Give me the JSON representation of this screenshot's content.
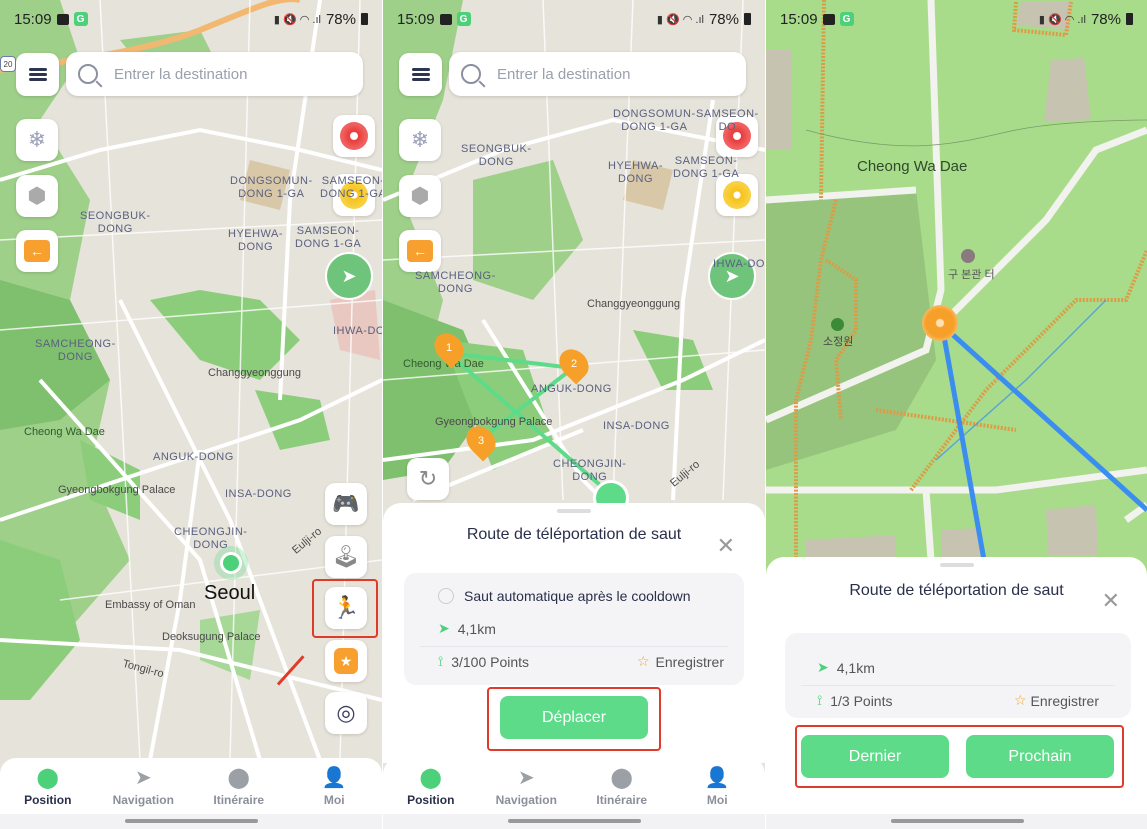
{
  "status_bar": {
    "time": "15:09",
    "battery": "78%"
  },
  "search": {
    "placeholder": "Entrer la destination"
  },
  "tabs": [
    {
      "label": "Position",
      "icon": "location-pin-icon",
      "active": true
    },
    {
      "label": "Navigation",
      "icon": "paper-plane-icon",
      "active": false
    },
    {
      "label": "Itinéraire",
      "icon": "route-icon",
      "active": false
    },
    {
      "label": "Moi",
      "icon": "user-icon",
      "active": false
    }
  ],
  "panel1": {
    "map_labels": {
      "dongsomun": "DONGSOMUN-\nDONG 1-GA",
      "samseon": "SAMSEON-\nDONG 1-GA",
      "seongbuk": "SEONGBUK-\nDONG",
      "hyehwa": "HYEHWA-\nDONG",
      "samcheong": "SAMCHEONG-\nDONG",
      "ihwa": "IHWA-DO",
      "changgyeonggung": "Changgyeonggung",
      "cheong_wa_dae": "Cheong Wa Dae",
      "anguk": "ANGUK-DONG",
      "gyeongbokgung": "Gyeongbokgung Palace",
      "insa": "INSA-DONG",
      "cheongjin": "CHEONGJIN-\nDONG",
      "seoul": "Seoul",
      "oman": "Embassy of Oman",
      "deoksugung": "Deoksugung Palace",
      "eulji": "Eulji-ro",
      "tongil": "Tongil-ro",
      "route_shield": "20"
    }
  },
  "panel2": {
    "map_labels": {
      "dongsomun": "DONGSOMUN-\nDONG 1-GA",
      "samseon_top": "SAMSEON-\nDO",
      "seongbuk": "SEONGBUK-\nDONG",
      "hyehwa": "HYEHWA-\nDONG",
      "samseon": "SAMSEON-\nDONG 1-GA",
      "samcheong": "SAMCHEONG-\nDONG",
      "changgyeonggung": "Changgyeonggung",
      "cheong_wa_dae": "Cheong Wa Dae",
      "anguk": "ANGUK-DONG",
      "gyeongbokgung": "Gyeongbokgung Palace",
      "insa": "INSA-DONG",
      "cheongjin": "CHEONGJIN-\nDONG",
      "eulji": "Eulji-ro",
      "ihwa": "IHWA-DON"
    },
    "waypoints": [
      "1",
      "2",
      "3"
    ],
    "sheet": {
      "title": "Route de téléportation de saut",
      "auto_jump_label": "Saut automatique après le cooldown",
      "auto_jump_checked": false,
      "distance": "4,1km",
      "points": "3/100 Points",
      "save_label": "Enregistrer",
      "move_button": "Déplacer"
    }
  },
  "panel3": {
    "map_labels": {
      "cheong_wa_dae": "Cheong Wa Dae",
      "gubongwan": "구 본관 터",
      "sojeongwon": "소정원"
    },
    "sheet": {
      "title": "Route de téléportation de saut",
      "distance": "4,1km",
      "points": "1/3 Points",
      "save_label": "Enregistrer",
      "prev_button": "Dernier",
      "next_button": "Prochain"
    }
  },
  "colors": {
    "accent_green": "#5ddb89",
    "highlight_red": "#e03a2a",
    "waypoint_orange": "#f7a029",
    "route_blue": "#3b8ef0"
  }
}
